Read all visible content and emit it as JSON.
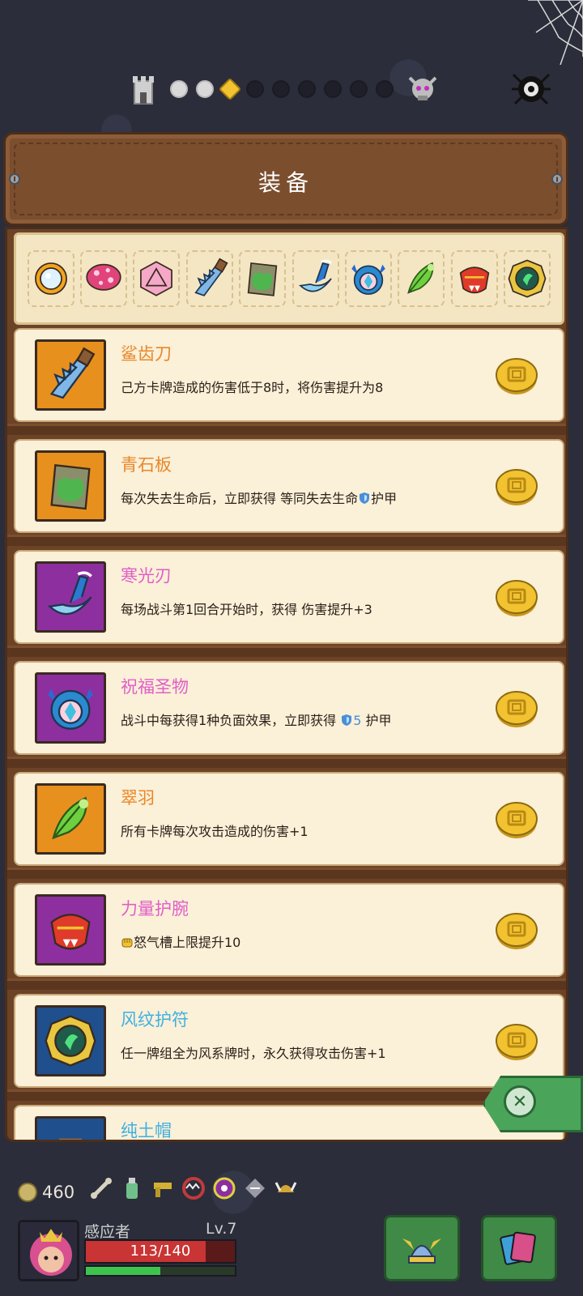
{
  "panel": {
    "title": "装备"
  },
  "map": {
    "nodes": [
      "done",
      "done",
      "current",
      "todo",
      "todo",
      "todo",
      "todo",
      "todo",
      "todo"
    ]
  },
  "strip_icons": [
    "crystal-ball-icon",
    "mushroom-icon",
    "d20-die-icon",
    "shark-tooth-blade-icon",
    "green-stone-slab-icon",
    "frost-blade-icon",
    "blessed-relic-icon",
    "jade-feather-icon",
    "power-bracer-icon",
    "wind-amulet-icon"
  ],
  "items": [
    {
      "name": "鲨齿刀",
      "name_color": "#e8872a",
      "frame_color": "#e8901e",
      "icon": "shark-tooth-blade-icon",
      "desc": "己方卡牌造成的伤害低于8时，将伤害提升为8"
    },
    {
      "name": "青石板",
      "name_color": "#e8872a",
      "frame_color": "#e8901e",
      "icon": "green-stone-slab-icon",
      "desc_pre": "每次失去生命后，立即获得 等同失去生命",
      "desc_icon": "shield-icon",
      "desc_post": "护甲"
    },
    {
      "name": "寒光刃",
      "name_color": "#e05fc8",
      "frame_color": "#8e2fa0",
      "icon": "frost-blade-icon",
      "desc": "每场战斗第1回合开始时，获得 伤害提升+3"
    },
    {
      "name": "祝福圣物",
      "name_color": "#e05fc8",
      "frame_color": "#8e2fa0",
      "icon": "blessed-relic-icon",
      "desc_pre": "战斗中每获得1种负面效果，立即获得 ",
      "desc_icon": "shield-icon",
      "desc_num": "5",
      "desc_post": " 护甲"
    },
    {
      "name": "翠羽",
      "name_color": "#e8872a",
      "frame_color": "#e8901e",
      "icon": "jade-feather-icon",
      "desc": "所有卡牌每次攻击造成的伤害+1"
    },
    {
      "name": "力量护腕",
      "name_color": "#e05fc8",
      "frame_color": "#8e2fa0",
      "icon": "power-bracer-icon",
      "desc_icon": "fist-icon",
      "desc_post": "怒气槽上限提升10"
    },
    {
      "name": "风纹护符",
      "name_color": "#3fb0e0",
      "frame_color": "#1f4f8c",
      "icon": "wind-amulet-icon",
      "desc": "任一牌组全为风系牌时，永久获得攻击伤害+1"
    },
    {
      "name": "纯土帽",
      "name_color": "#3fb0e0",
      "frame_color": "#1f4f8c",
      "icon": "hat-icon",
      "desc": ""
    }
  ],
  "hud": {
    "gold": "460",
    "player_name": "感应者",
    "level": "Lv.7",
    "hp": "113/140",
    "hp_fraction": 0.807,
    "xp_fraction": 0.5
  }
}
